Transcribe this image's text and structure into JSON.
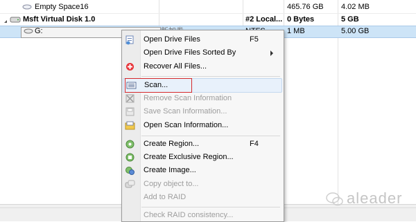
{
  "rows": [
    {
      "name": "Empty Space16",
      "size": "465.76 GB",
      "offset": "4.02 MB"
    },
    {
      "name": "Msft Virtual Disk 1.0",
      "col3": "#2 Local...",
      "size": "0 Bytes",
      "offset": "5 GB"
    },
    {
      "name": "G:",
      "label": "新加卷",
      "fs": "NTFS",
      "size": "1 MB",
      "offset": "5.00 GB"
    }
  ],
  "menu": {
    "items": [
      {
        "label": "Open Drive Files",
        "shortcut": "F5",
        "icon": "folder-files-icon"
      },
      {
        "label": "Open Drive Files Sorted By",
        "icon": "none"
      },
      {
        "label": "Recover All Files...",
        "icon": "recover-icon"
      },
      {
        "label": "Scan...",
        "icon": "scan-icon"
      },
      {
        "label": "Remove Scan Information",
        "icon": "remove-scan-icon"
      },
      {
        "label": "Save Scan Information...",
        "icon": "save-scan-icon"
      },
      {
        "label": "Open Scan Information...",
        "icon": "open-scan-icon"
      },
      {
        "label": "Create Region...",
        "shortcut": "F4",
        "icon": "region-icon"
      },
      {
        "label": "Create Exclusive Region...",
        "icon": "exclusive-region-icon"
      },
      {
        "label": "Create Image...",
        "icon": "image-icon"
      },
      {
        "label": "Copy object to...",
        "icon": "copy-icon"
      },
      {
        "label": "Add to RAID",
        "icon": "none"
      },
      {
        "label": "Check RAID consistency...",
        "icon": "none"
      }
    ]
  },
  "watermark": {
    "text": "aleader"
  },
  "colors": {
    "selection": "#cde4f7",
    "highlight_border": "#d5282a"
  }
}
